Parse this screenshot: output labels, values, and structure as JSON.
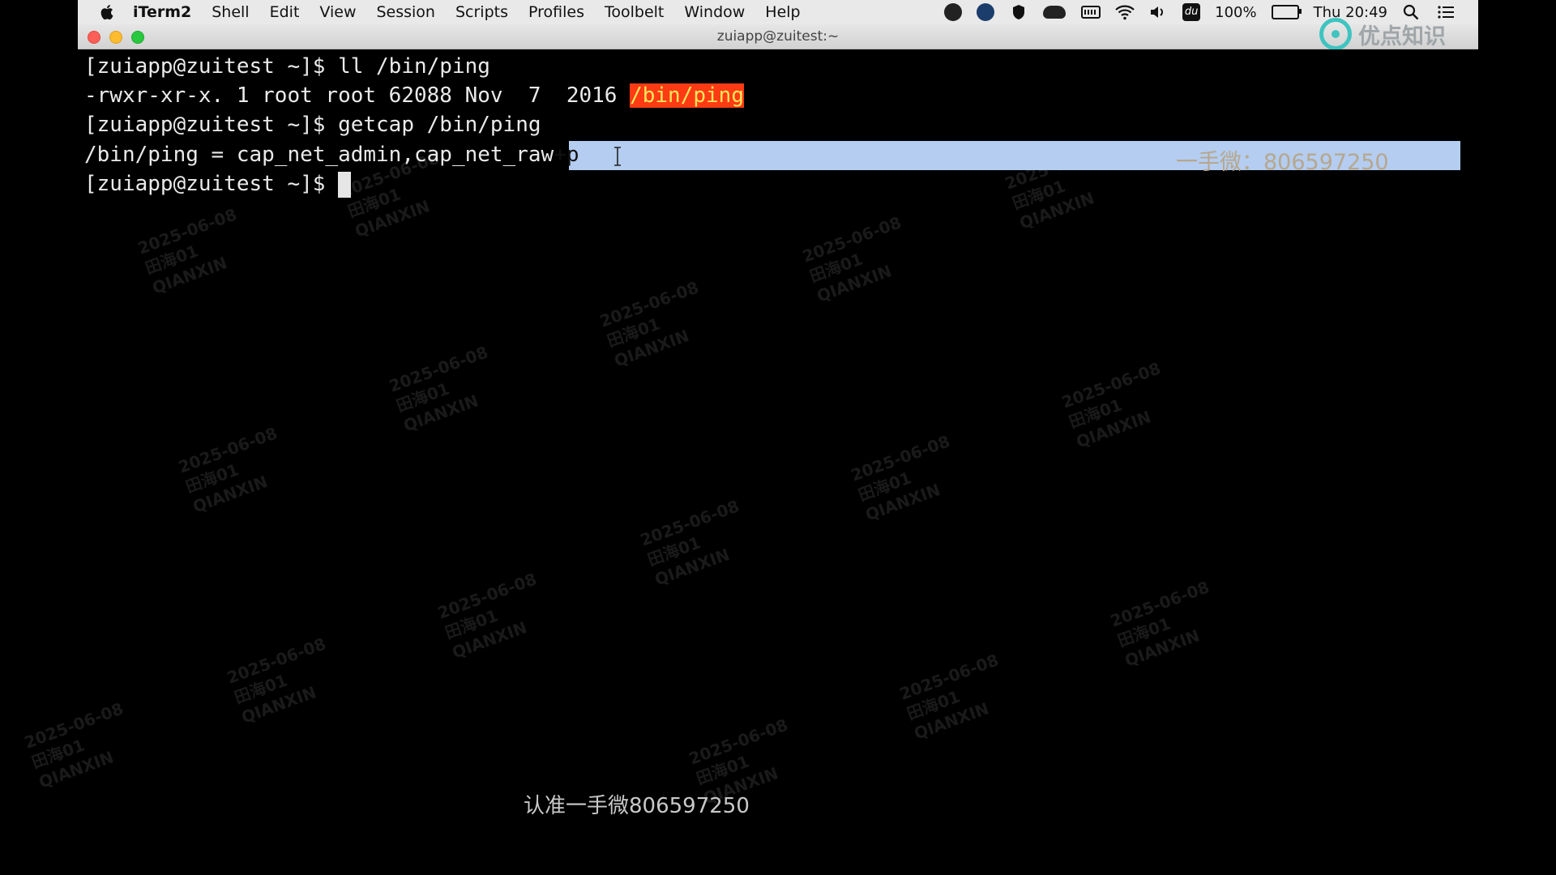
{
  "menubar": {
    "app_name": "iTerm2",
    "items": [
      "Shell",
      "Edit",
      "View",
      "Session",
      "Scripts",
      "Profiles",
      "Toolbelt",
      "Window",
      "Help"
    ],
    "status": {
      "battery": "100%",
      "clock": "Thu 20:49",
      "badge_text": "du"
    }
  },
  "window": {
    "title": "zuiapp@zuitest:~"
  },
  "terminal": {
    "lines": [
      {
        "text": "[zuiapp@zuitest ~]$ ll /bin/ping"
      },
      {
        "prefix": "-rwxr-xr-x. 1 root root 62088 Nov  7  2016 ",
        "highlight": "/bin/ping"
      },
      {
        "text": "[zuiapp@zuitest ~]$ getcap /bin/ping"
      },
      {
        "prefix": "/bin/ping = cap_net_admin,cap_net_raw",
        "selected": "+p"
      },
      {
        "text": "[zuiapp@zuitest ~]$ "
      }
    ]
  },
  "overlay": {
    "logo_text": "优点知识",
    "contact_top": "一手微：806597250",
    "contact_bottom": "认准一手微806597250",
    "watermark_lines": [
      "2025-06-08",
      "田海01",
      "QIANXIN"
    ]
  },
  "colors": {
    "terminal_bg": "#000000",
    "terminal_fg": "#eaeaea",
    "highlight_bg": "#ff3b14",
    "highlight_fg": "#ffe65a",
    "selection_bg": "#b4cdf0",
    "logo_accent": "#3fc4c0"
  }
}
